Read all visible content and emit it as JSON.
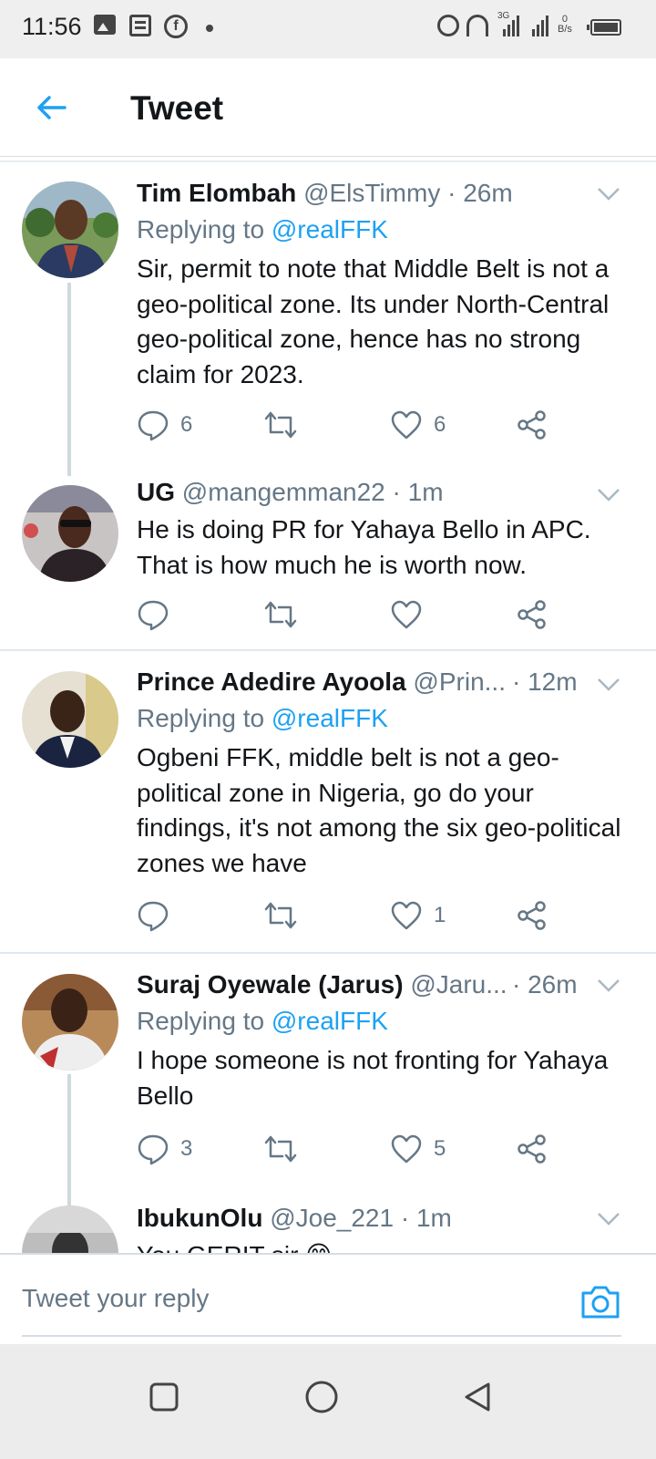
{
  "status_bar": {
    "time": "11:56",
    "network_type": "3G",
    "net_speed_value": "0",
    "net_speed_unit": "B/s"
  },
  "header": {
    "title": "Tweet"
  },
  "tweets": [
    {
      "name": "Tim Elombah",
      "handle": "@ElsTimmy",
      "time": "· 26m",
      "reply_prefix": "Replying to ",
      "reply_to": "@realFFK",
      "text": "Sir, permit to note that Middle Belt is not a geo-political zone. Its under North-Central geo-political zone, hence has no strong claim for 2023.",
      "replies": "6",
      "retweets": "",
      "likes": "6"
    },
    {
      "name": "UG",
      "handle": "@mangemman22",
      "time": "· 1m",
      "text": "He is doing PR for Yahaya Bello in APC. That is how much he is worth now.",
      "replies": "",
      "retweets": "",
      "likes": ""
    },
    {
      "name": "Prince Adedire Ayoola",
      "handle": "@Prin...",
      "time": "· 12m",
      "reply_prefix": "Replying to ",
      "reply_to": "@realFFK",
      "text": "Ogbeni FFK, middle belt is not a geo-political zone in Nigeria, go do your findings, it's not among the six geo-political zones we have",
      "replies": "",
      "retweets": "",
      "likes": "1"
    },
    {
      "name": "Suraj Oyewale (Jarus)",
      "handle": "@Jaru...",
      "time": "· 26m",
      "reply_prefix": "Replying to ",
      "reply_to": "@realFFK",
      "text": "I hope someone is not fronting for Yahaya Bello",
      "replies": "3",
      "retweets": "",
      "likes": "5"
    },
    {
      "name": "IbukunOlu",
      "handle": "@Joe_221",
      "time": "· 1m",
      "text": "You GERIT sir 😊"
    }
  ],
  "reply_box": {
    "placeholder": "Tweet your reply"
  },
  "colors": {
    "accent": "#1da1f2",
    "text_primary": "#14171a",
    "text_secondary": "#657786",
    "divider": "#e1e8ed"
  },
  "icons": {
    "back": "arrow-left-icon",
    "reply": "speech-bubble-icon",
    "retweet": "retweet-icon",
    "like": "heart-icon",
    "share": "share-icon",
    "more": "chevron-down-icon",
    "camera": "camera-icon",
    "nav_recents": "square-icon",
    "nav_home": "circle-icon",
    "nav_back": "triangle-back-icon"
  }
}
